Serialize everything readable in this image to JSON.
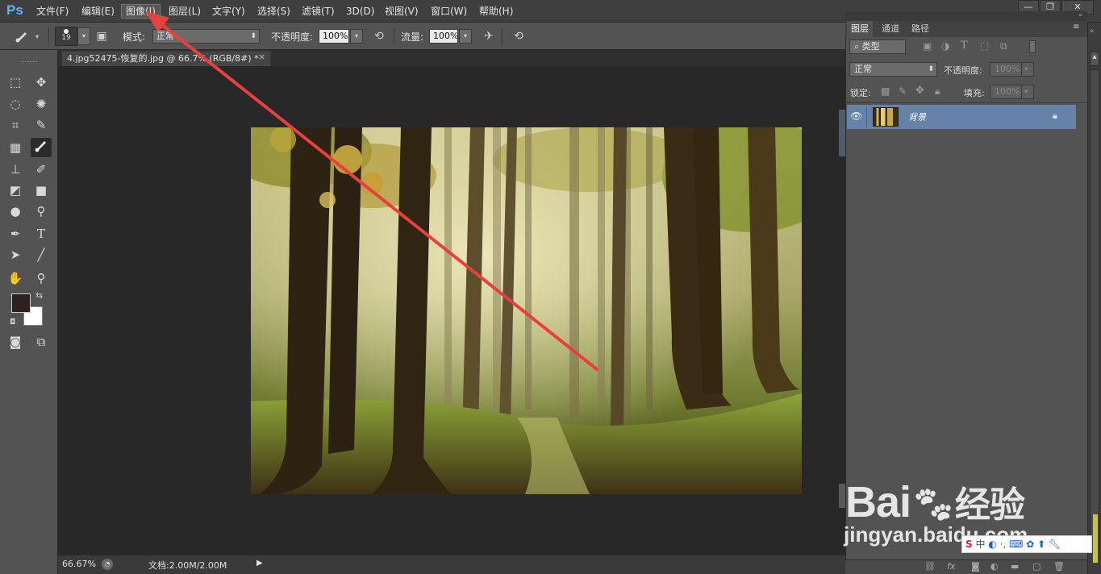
{
  "app": {
    "logo": "Ps",
    "menu": [
      "文件(F)",
      "编辑(E)",
      "图像(I)",
      "图层(L)",
      "文字(Y)",
      "选择(S)",
      "滤镜(T)",
      "3D(D)",
      "视图(V)",
      "窗口(W)",
      "帮助(H)"
    ],
    "active_menu_index": 2,
    "window_controls": [
      "minimize-icon",
      "restore-icon",
      "close-icon"
    ]
  },
  "options": {
    "brush_size": "19",
    "mode_label": "模式:",
    "mode_value": "正常",
    "opacity_label": "不透明度:",
    "opacity_value": "100%",
    "flow_label": "流量:",
    "flow_value": "100%"
  },
  "document": {
    "tab_title": "4.jpg52475-恢复的.jpg @ 66.7% (RGB/8#) *",
    "close": "×"
  },
  "status": {
    "zoom": "66.67%",
    "doc_info": "文档:2.00M/2.00M"
  },
  "colors": {
    "foreground": "#2f221e",
    "background": "#ffffff",
    "accent_selected_layer": "#6583a9",
    "annotation_arrow": "#e8403f"
  },
  "layers_panel": {
    "tabs": [
      "图层",
      "通道",
      "路径"
    ],
    "active_tab_index": 0,
    "filter_kind": "类型",
    "blend_mode": "正常",
    "opacity_label": "不透明度:",
    "opacity_value": "100%",
    "lock_label": "锁定:",
    "fill_label": "填充:",
    "fill_value": "100%",
    "layers": [
      {
        "name": "背景",
        "visible": true,
        "locked": true,
        "selected": true
      }
    ]
  },
  "watermark": {
    "brand": "Bai",
    "brand_suffix": "经验",
    "url": "jingyan.baidu.com",
    "ime": "S 中 ·,"
  }
}
